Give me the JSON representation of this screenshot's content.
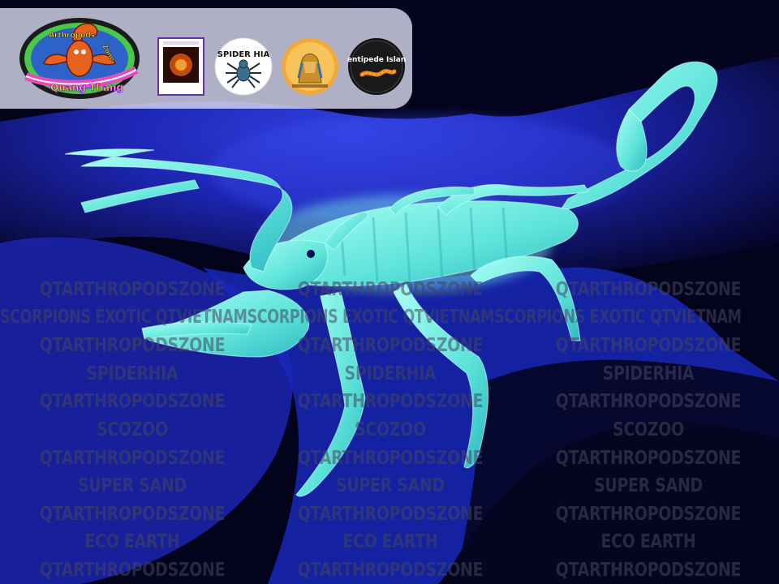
{
  "photo": {
    "subject": "scorpion",
    "colors": {
      "background_dark": "#02021a",
      "uv_blue": "#1f2fd0",
      "fluorescent_body": "#58e6dc",
      "fluorescent_highlight": "#b8fff6"
    }
  },
  "logos": {
    "main": {
      "top_text": "Arthropods",
      "side_text": "Zone",
      "bottom_text": "Quang Thang"
    },
    "spider_hia": {
      "text": "SPIDER HIA"
    },
    "centipede_island": {
      "text": "Centipede Island"
    }
  },
  "watermark": {
    "column_lines": [
      "QTARTHROPODSZONE",
      "",
      "QTARTHROPODSZONE",
      "SPIDERHIA",
      "QTARTHROPODSZONE",
      "SCOZOO",
      "QTARTHROPODSZONE",
      "SUPER SAND",
      "QTARTHROPODSZONE",
      "ECO EARTH",
      "QTARTHROPODSZONE"
    ],
    "scorpions_line": "SCORPIONS EXOTIC QTVIETNAMSCORPIONS EXOTIC QTVIETNAMSCORPIONS EXOTIC QTVIETNAM"
  }
}
